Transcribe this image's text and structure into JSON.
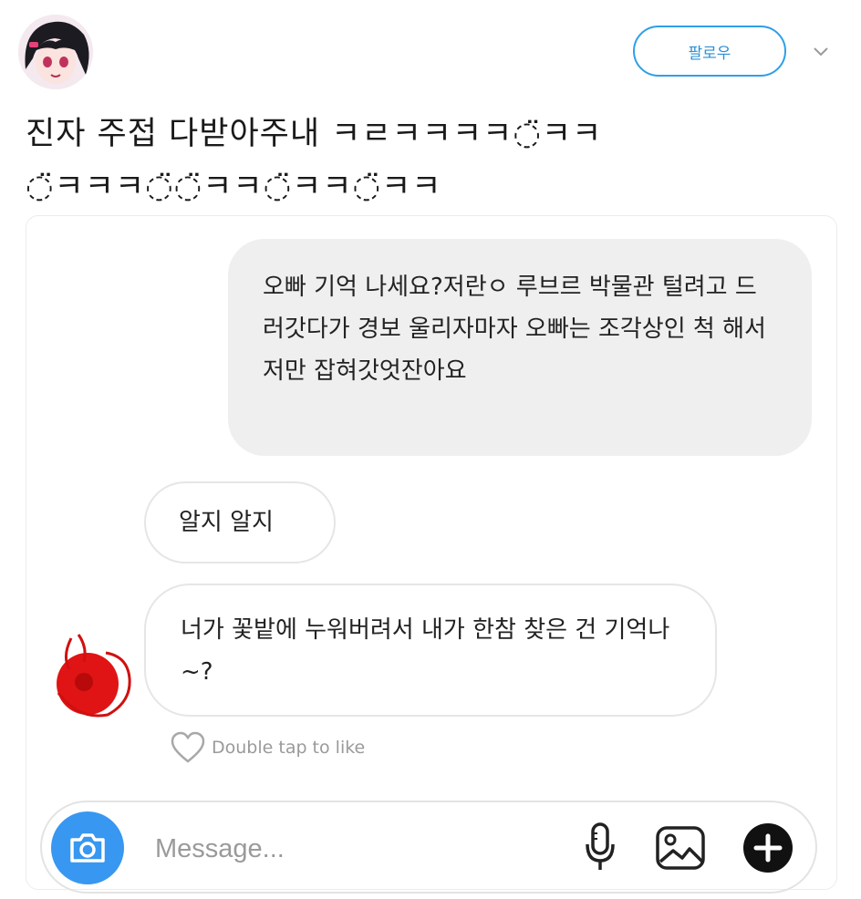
{
  "header": {
    "follow_label": "팔로우",
    "tweet_line1": "진자 주접 다받아주내    ㅋㄹㅋㅋㅋㅋ◌̈ㅋㅋ",
    "tweet_line2": "◌̈ㅋㅋㅋ◌̈◌̈ㅋㅋ◌̈ㅋㅋ◌̈ㅋㅋ"
  },
  "messages": [
    {
      "direction": "outgoing",
      "text": "오빠 기억 나세요?저란ㅇ 루브르 박물관 털려고 드러갓다가 경보 울리자마자 오빠는 조각상인 척 해서 저만 잡혀갓엇잔아요"
    },
    {
      "direction": "incoming",
      "text": "알지 알지"
    },
    {
      "direction": "incoming",
      "text": "너가 꽃밭에 누워버려서 내가 한참 찾은 건 기억나~?"
    }
  ],
  "like_hint": "Double tap to like",
  "composer": {
    "placeholder": "Message...",
    "icons": [
      "camera-icon",
      "microphone-icon",
      "gallery-icon",
      "plus-icon"
    ]
  },
  "colors": {
    "accent_blue": "#3897f0",
    "follow_border": "#2f9fe6",
    "outgoing_bubble": "#efefef"
  }
}
